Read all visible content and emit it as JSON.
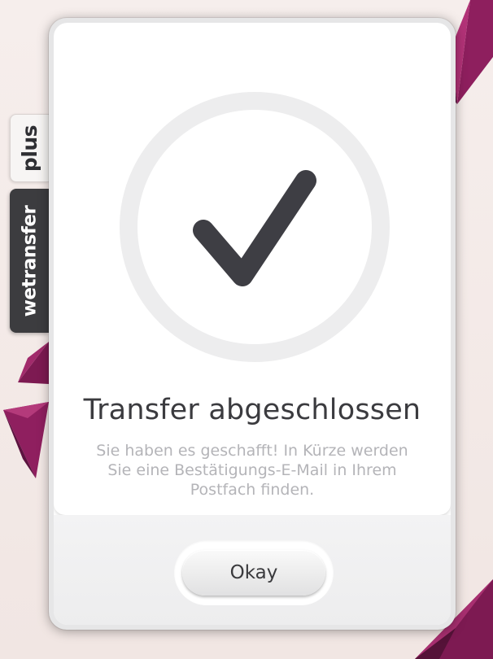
{
  "brand": {
    "tab_plus_label": "plus",
    "tab_wetransfer_label": "wetransfer"
  },
  "modal": {
    "title": "Transfer abgeschlossen",
    "message": "Sie haben es geschafft! In Kürze werden Sie eine Bestätigungs-E-Mail in Ihrem Postfach finden.",
    "status_icon": "checkmark-icon",
    "okay_label": "Okay"
  },
  "colors": {
    "accent": "#8e1f5e",
    "check": "#3e3e44",
    "circle": "#ededee",
    "title": "#3b3b3f",
    "message": "#b4b4b8"
  }
}
